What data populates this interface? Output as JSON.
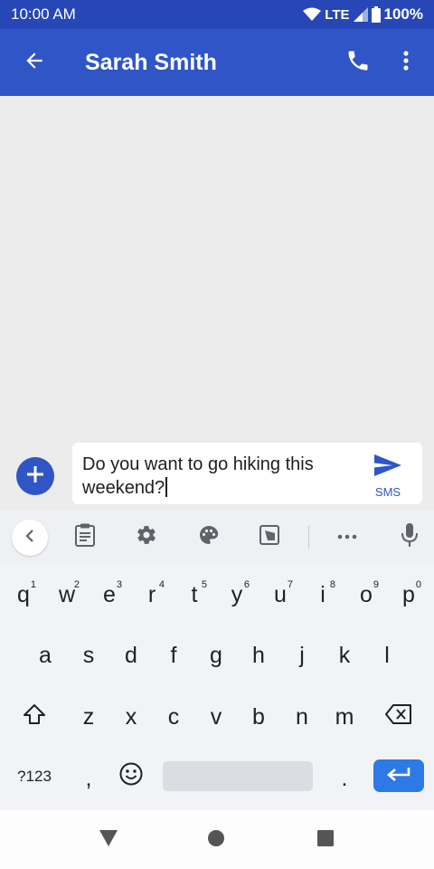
{
  "status": {
    "time": "10:00 AM",
    "network": "LTE",
    "battery": "100%"
  },
  "app_bar": {
    "title": "Sarah Smith"
  },
  "compose": {
    "text": "Do you want to go hiking this weekend?",
    "send_label": "SMS"
  },
  "keyboard": {
    "row1": [
      {
        "key": "q",
        "hint": "1"
      },
      {
        "key": "w",
        "hint": "2"
      },
      {
        "key": "e",
        "hint": "3"
      },
      {
        "key": "r",
        "hint": "4"
      },
      {
        "key": "t",
        "hint": "5"
      },
      {
        "key": "y",
        "hint": "6"
      },
      {
        "key": "u",
        "hint": "7"
      },
      {
        "key": "i",
        "hint": "8"
      },
      {
        "key": "o",
        "hint": "9"
      },
      {
        "key": "p",
        "hint": "0"
      }
    ],
    "row2": [
      "a",
      "s",
      "d",
      "f",
      "g",
      "h",
      "j",
      "k",
      "l"
    ],
    "row3": [
      "z",
      "x",
      "c",
      "v",
      "b",
      "n",
      "m"
    ],
    "symbols_label": "?123",
    "comma": ",",
    "period": "."
  },
  "colors": {
    "app_bar": "#2f55c6",
    "status_bar": "#2747b7",
    "accent": "#2d7ae6"
  }
}
